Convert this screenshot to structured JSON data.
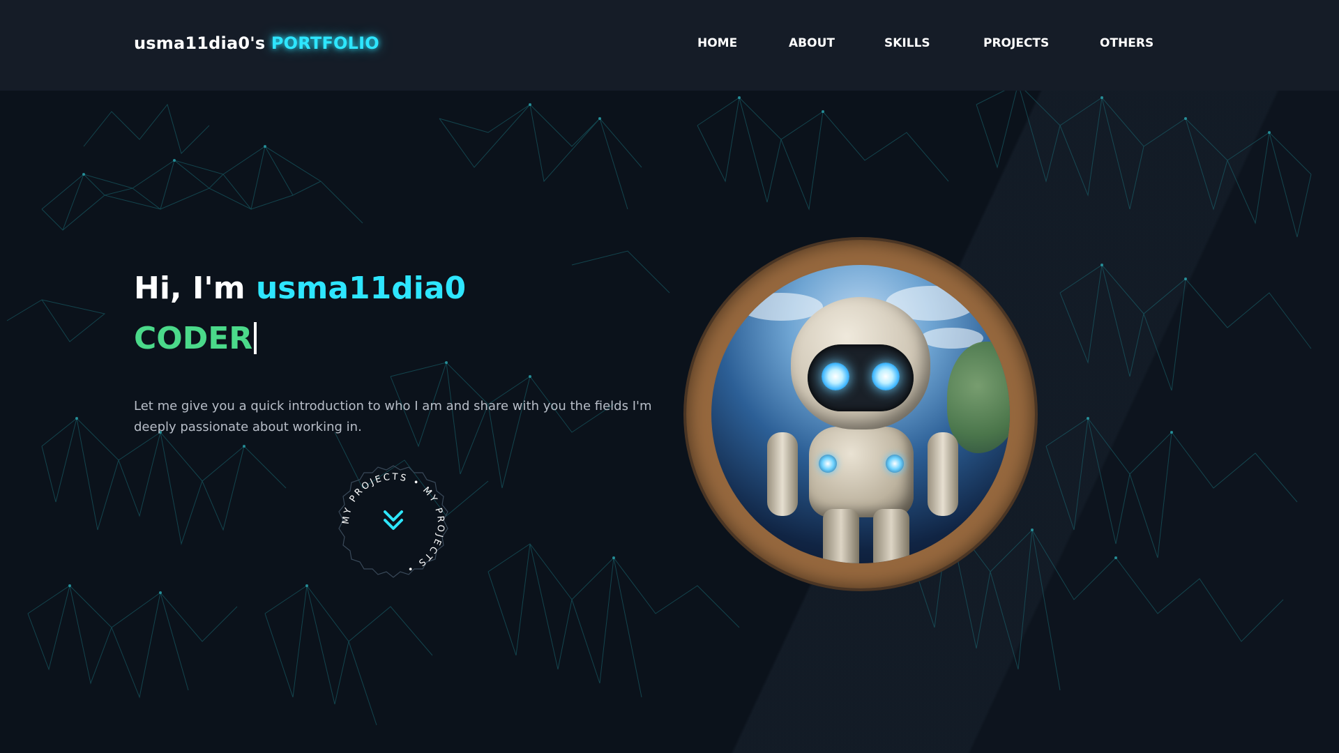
{
  "header": {
    "brand_prefix": "usma11dia0's ",
    "brand_accent": "PORTFOLIO",
    "nav": [
      {
        "label": "HOME"
      },
      {
        "label": "ABOUT"
      },
      {
        "label": "SKILLS"
      },
      {
        "label": "PROJECTS"
      },
      {
        "label": "OTHERS"
      }
    ]
  },
  "hero": {
    "greeting": "Hi, I'm ",
    "name": "usma11dia0",
    "role": "CODER",
    "intro": "Let me give you a quick introduction to who I am and share with you the fields I'm deeply passionate about working in.",
    "badge_text": "MY PROJECTS • MY PROJECTS • ",
    "badge_icon": "double-chevron-down-icon",
    "portrait_alt": "robot-astronaut-avatar"
  },
  "colors": {
    "accent_cyan": "#2ee6ff",
    "accent_green": "#4bd98a",
    "background": "#0b121b",
    "header_bg": "#151c27"
  }
}
